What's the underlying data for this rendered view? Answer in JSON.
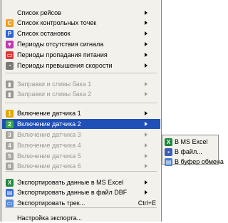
{
  "menu": {
    "items": [
      {
        "label": "Список рейсов",
        "icon": "none",
        "arrow": true
      },
      {
        "label": "Список контрольных точек",
        "icon": "c-letter-icon",
        "glyph": "C",
        "color": "#f0a020",
        "arrow": true
      },
      {
        "label": "Список остановок",
        "icon": "p-letter-icon",
        "glyph": "P",
        "color": "#2a66d8",
        "arrow": true
      },
      {
        "label": "Периоды отсутствия сигнала",
        "icon": "antenna-icon",
        "glyph": "▼",
        "color": "#c037b0",
        "arrow": true
      },
      {
        "label": "Периоды пропадания питания",
        "icon": "power-icon",
        "glyph": "▭",
        "color": "#d83a3a",
        "arrow": true
      },
      {
        "label": "Периоды превышения скорости",
        "icon": "speedometer-icon",
        "glyph": "◔",
        "color": "#7a7a7a",
        "arrow": true
      },
      {
        "label": "Заправки и сливы бака 1",
        "icon": "fuel-tank-icon",
        "glyph": "▮",
        "color": "#9a9890",
        "arrow": true,
        "disabled": true
      },
      {
        "label": "Заправки и сливы бака 2",
        "icon": "fuel-tank-icon",
        "glyph": "▮",
        "color": "#9a9890",
        "arrow": true,
        "disabled": true
      },
      {
        "label": "Включение датчика 1",
        "icon": "sensor-1-icon",
        "glyph": "1",
        "color": "#e0a800",
        "arrow": true
      },
      {
        "label": "Включение датчика 2",
        "icon": "sensor-2-icon",
        "glyph": "2",
        "color": "#3aa84a",
        "arrow": true,
        "selected": true
      },
      {
        "label": "Включение датчика 3",
        "icon": "sensor-3-icon",
        "glyph": "3",
        "color": "#a8a69f",
        "arrow": true,
        "disabled": true
      },
      {
        "label": "Включение датчика 4",
        "icon": "sensor-4-icon",
        "glyph": "4",
        "color": "#a8a69f",
        "arrow": true,
        "disabled": true
      },
      {
        "label": "Включение датчика 5",
        "icon": "sensor-5-icon",
        "glyph": "5",
        "color": "#a8a69f",
        "arrow": true,
        "disabled": true
      },
      {
        "label": "Включение датчика 6",
        "icon": "sensor-6-icon",
        "glyph": "6",
        "color": "#a8a69f",
        "arrow": true,
        "disabled": true
      },
      {
        "label": "Экспортировать данные в MS Excel",
        "icon": "excel-icon",
        "glyph": "X",
        "color": "#1e8a3c",
        "arrow": true
      },
      {
        "label": "Экспортировать данные в файл DBF",
        "icon": "dbf-file-icon",
        "glyph": "▤",
        "color": "#3a6fd0",
        "arrow": true
      },
      {
        "label": "Экспортировать трек...",
        "icon": "track-icon",
        "glyph": "▭",
        "color": "#5a8ad8",
        "shortcut": "Ctrl+E"
      },
      {
        "label": "Настройка экспорта...",
        "icon": "none"
      }
    ]
  },
  "submenu": {
    "items": [
      {
        "label": "В MS Excel",
        "icon": "excel-icon",
        "glyph": "X",
        "color": "#1e8a3c"
      },
      {
        "label": "В файл...",
        "icon": "floppy-icon",
        "glyph": "▪",
        "color": "#3a5fb8"
      },
      {
        "label": "В буфер обмена",
        "icon": "clipboard-icon",
        "glyph": "▤",
        "color": "#4a80d0"
      }
    ]
  }
}
